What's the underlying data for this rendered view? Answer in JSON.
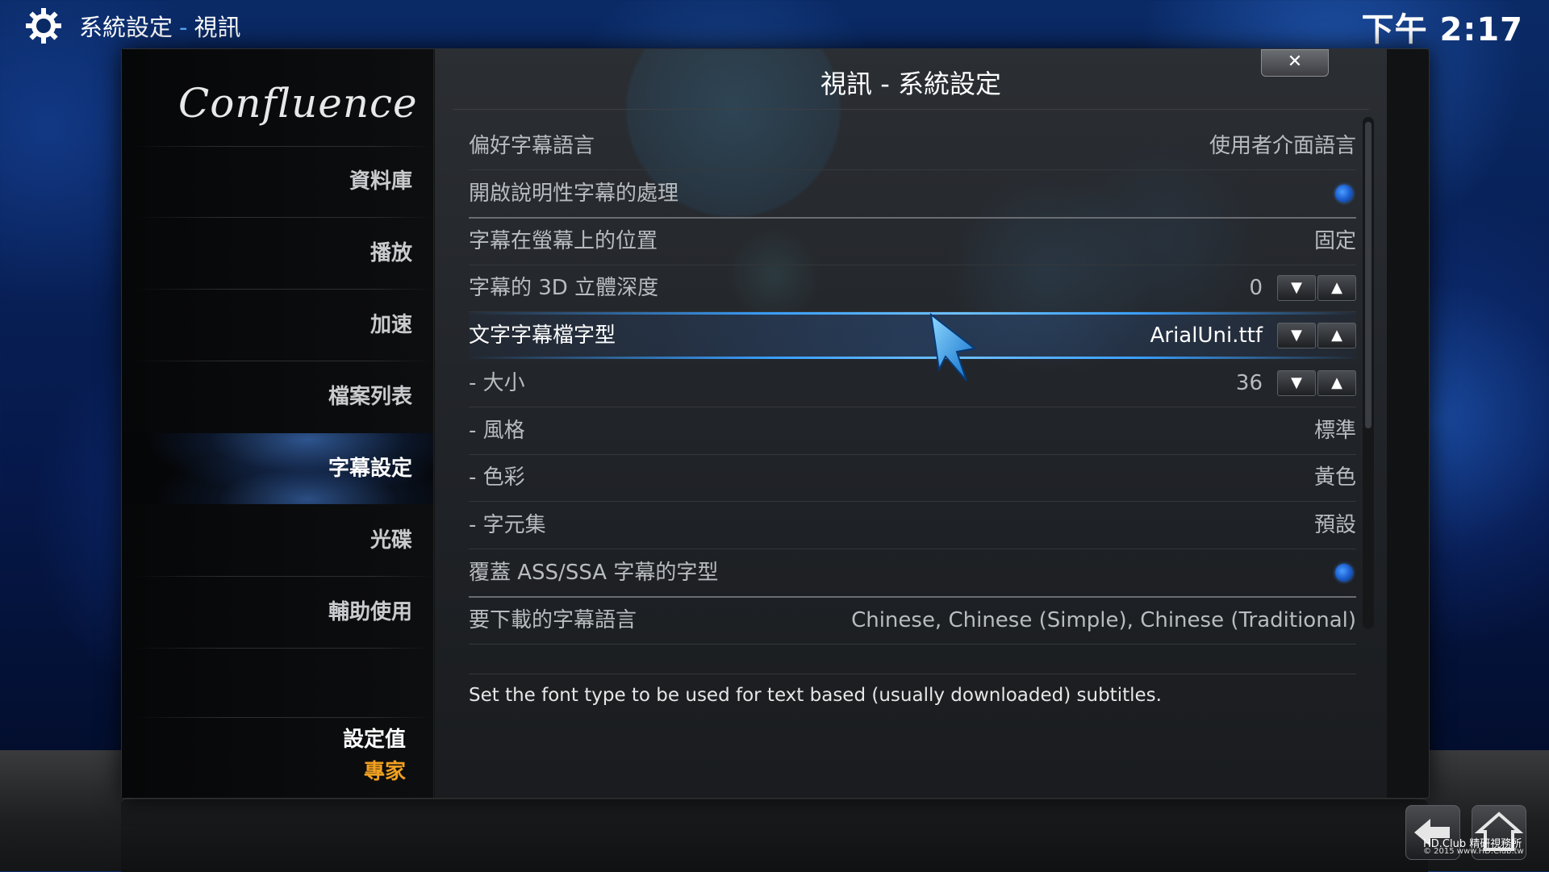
{
  "header": {
    "section": "系統設定",
    "separator": "-",
    "page": "視訊",
    "clock": "下午 2:17"
  },
  "sidebar": {
    "logo": "Confluence",
    "items": [
      {
        "label": "資料庫"
      },
      {
        "label": "播放"
      },
      {
        "label": "加速"
      },
      {
        "label": "檔案列表"
      },
      {
        "label": "字幕設定",
        "active": true
      },
      {
        "label": "光碟"
      },
      {
        "label": "輔助使用"
      }
    ],
    "level_title": "設定值",
    "level_value": "專家"
  },
  "dialog": {
    "title": "視訊 - 系統設定",
    "close_label": "✕"
  },
  "settings": [
    {
      "label": "偏好字幕語言",
      "value": "使用者介面語言"
    },
    {
      "label": "開啟說明性字幕的處理",
      "type": "radio",
      "checked": true
    },
    {
      "label": "字幕在螢幕上的位置",
      "value": "固定"
    },
    {
      "label": "字幕的 3D 立體深度",
      "value": "0",
      "type": "spinner"
    },
    {
      "label": "文字字幕檔字型",
      "value": "ArialUni.ttf",
      "type": "spinner",
      "focused": true
    },
    {
      "label": "- 大小",
      "value": "36",
      "type": "spinner"
    },
    {
      "label": "- 風格",
      "value": "標準"
    },
    {
      "label": "- 色彩",
      "value": "黃色"
    },
    {
      "label": "- 字元集",
      "value": "預設"
    },
    {
      "label": "覆蓋 ASS/SSA 字幕的字型",
      "type": "radio",
      "checked": true
    },
    {
      "label": "要下載的字幕語言",
      "value": "Chinese, Chinese (Simple), Chinese (Traditional)"
    }
  ],
  "spinner": {
    "down": "▼",
    "up": "▲"
  },
  "description": "Set the font type to be used for text based (usually downloaded) subtitles.",
  "watermark": {
    "line1": "HD.Club 精研視務所",
    "line2": "© 2015  www.HD.Club.tw"
  },
  "colors": {
    "accent": "#3aa0ff",
    "expert": "#f0a020"
  }
}
